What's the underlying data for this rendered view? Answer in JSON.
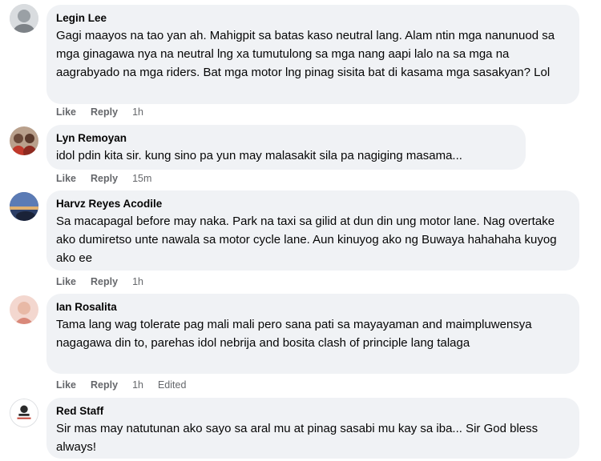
{
  "comments": [
    {
      "author": "Legin Lee",
      "text": "Gagi maayos na tao yan ah. Mahigpit sa batas kaso neutral lang. Alam ntin mga nanunuod sa mga ginagawa nya na neutral lng xa tumutulong sa mga nang aapi lalo na sa mga na aagrabyado na mga riders. Bat mga motor lng pinag sisita bat di kasama mga sasakyan? Lol",
      "like": "Like",
      "reply": "Reply",
      "time": "1h",
      "edited": ""
    },
    {
      "author": "Lyn Remoyan",
      "text": "idol pdin kita sir. kung sino pa yun may malasakit sila pa nagiging masama...",
      "like": "Like",
      "reply": "Reply",
      "time": "15m",
      "edited": ""
    },
    {
      "author": "Harvz Reyes Acodile",
      "text": "Sa macapagal before may naka. Park na taxi sa gilid at dun din ung motor lane. Nag overtake ako dumiretso unte nawala sa motor cycle lane. Aun kinuyog ako ng Buwaya hahahaha kuyog ako ee",
      "like": "Like",
      "reply": "Reply",
      "time": "1h",
      "edited": ""
    },
    {
      "author": "Ian Rosalita",
      "text": "Tama lang wag tolerate pag mali mali pero sana pati sa mayayaman and maimpluwensya nagagawa din to, parehas idol nebrija and bosita clash of principle lang talaga",
      "like": "Like",
      "reply": "Reply",
      "time": "1h",
      "edited": "Edited"
    },
    {
      "author": "Red Staff",
      "text": "Sir mas may natutunan ako sayo sa aral mu at pinag sasabi mu kay sa iba... Sir God bless always!",
      "like": "",
      "reply": "",
      "time": "",
      "edited": ""
    }
  ],
  "colors": {
    "bubble": "#f0f2f5",
    "meta": "#65676b",
    "text": "#050505"
  }
}
